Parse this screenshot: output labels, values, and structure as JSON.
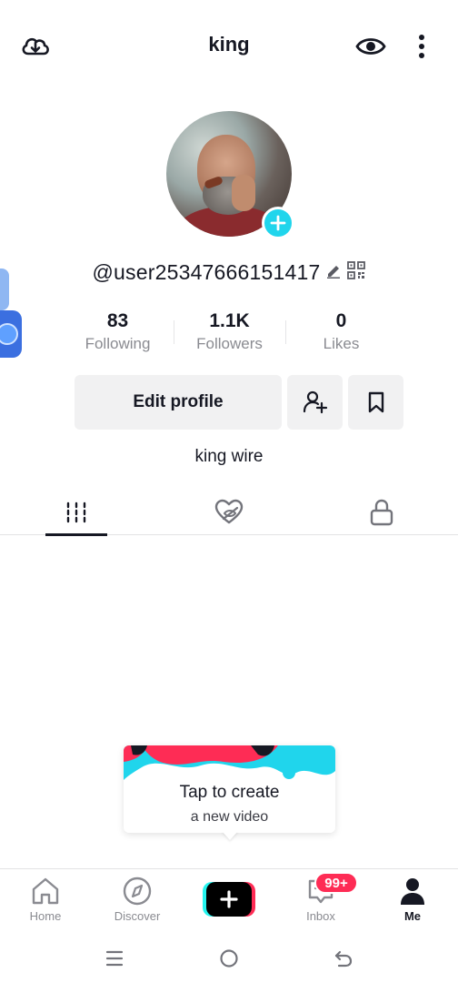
{
  "header": {
    "title": "king",
    "icons": [
      "download-cloud-icon",
      "eye-icon",
      "more-vertical-icon"
    ]
  },
  "profile": {
    "username": "@user25347666151417",
    "bio": "king wire"
  },
  "stats": [
    {
      "value": "83",
      "label": "Following"
    },
    {
      "value": "1.1K",
      "label": "Followers"
    },
    {
      "value": "0",
      "label": "Likes"
    }
  ],
  "actions": {
    "edit_label": "Edit profile"
  },
  "tabs": [
    "videos-grid-icon",
    "liked-hidden-icon",
    "lock-icon"
  ],
  "tooltip": {
    "line1": "Tap to create",
    "line2": "a new video"
  },
  "bottom_nav": {
    "home": "Home",
    "discover": "Discover",
    "inbox": "Inbox",
    "inbox_badge": "99+",
    "me": "Me"
  },
  "colors": {
    "accent_cyan": "#20d5ec",
    "accent_red": "#fe2c55",
    "text_primary": "#161823",
    "text_secondary": "#8a8b91",
    "button_bg": "#f1f1f2"
  }
}
